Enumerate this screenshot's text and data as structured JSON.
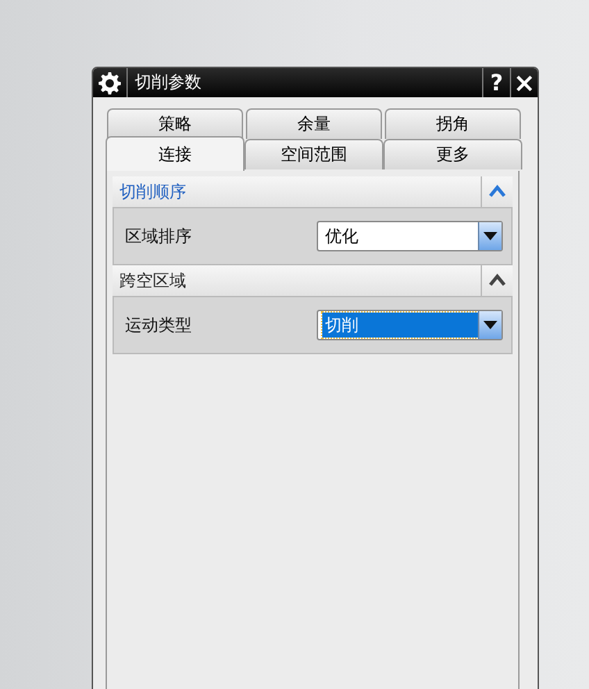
{
  "window": {
    "title": "切削参数"
  },
  "title_buttons": [
    {
      "kind": "help",
      "label": "?"
    },
    {
      "kind": "close",
      "label": "×"
    }
  ],
  "tab_rows": [
    {
      "tabs": [
        {
          "label": "策略",
          "selected": false
        },
        {
          "label": "余量",
          "selected": false
        },
        {
          "label": "拐角",
          "selected": false
        }
      ]
    },
    {
      "tabs": [
        {
          "label": "连接",
          "selected": true
        },
        {
          "label": "空间范围",
          "selected": false
        },
        {
          "label": "更多",
          "selected": false
        }
      ]
    }
  ],
  "sections": [
    {
      "title": "切削顺序",
      "highlighted": true,
      "expanded": true,
      "fields": [
        {
          "label": "区域排序",
          "value": "优化",
          "focused": false
        }
      ]
    },
    {
      "title": "跨空区域",
      "highlighted": false,
      "expanded": true,
      "fields": [
        {
          "label": "运动类型",
          "value": "切削",
          "focused": true
        }
      ]
    }
  ]
}
